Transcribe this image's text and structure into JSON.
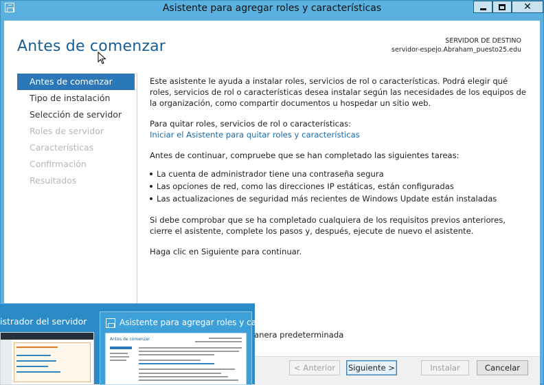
{
  "window": {
    "title": "Asistente para agregar roles y características"
  },
  "page": {
    "title": "Antes de comenzar",
    "server_label": "SERVIDOR DE DESTINO",
    "server_name": "servidor-espejo.Abraham_puesto25.edu"
  },
  "nav": {
    "items": [
      {
        "label": "Antes de comenzar",
        "state": "active"
      },
      {
        "label": "Tipo de instalación",
        "state": "enabled"
      },
      {
        "label": "Selección de servidor",
        "state": "enabled"
      },
      {
        "label": "Roles de servidor",
        "state": "disabled"
      },
      {
        "label": "Características",
        "state": "disabled"
      },
      {
        "label": "Confirmación",
        "state": "disabled"
      },
      {
        "label": "Resultados",
        "state": "disabled"
      }
    ]
  },
  "content": {
    "intro": "Este asistente le ayuda a instalar roles, servicios de rol o características. Podrá elegir qué roles, servicios de rol o características desea instalar según las necesidades de los equipos de la organización, como compartir documentos u hospedar un sitio web.",
    "remove_label": "Para quitar roles, servicios de rol o características:",
    "remove_link": "Iniciar el Asistente para quitar roles y características",
    "tasks_intro": "Antes de continuar, compruebe que se han completado las siguientes tareas:",
    "tasks": [
      "La cuenta de administrador tiene una contraseña segura",
      "Las opciones de red, como las direcciones IP estáticas, están configuradas",
      "Las actualizaciones de seguridad más recientes de Windows Update están instaladas"
    ],
    "requirements": "Si debe comprobar que se ha completado cualquiera de los requisitos previos anteriores, cierre el asistente, complete los pasos y, después, ejecute de nuevo el asistente.",
    "continue_hint": "Haga clic en Siguiente para continuar.",
    "default_partial": "anera predeterminada"
  },
  "buttons": {
    "previous": "< Anterior",
    "next": "Siguiente >",
    "install": "Instalar",
    "cancel": "Cancelar"
  },
  "taskbar_thumbs": {
    "server_manager_partial": "istrador del servidor",
    "wizard_partial": "Asistente para agregar roles y ca..."
  },
  "colors": {
    "titlebar": "#5ab0de",
    "accent": "#2b78b8",
    "title_text": "#1a5d8e",
    "link": "#1b6aa8"
  }
}
